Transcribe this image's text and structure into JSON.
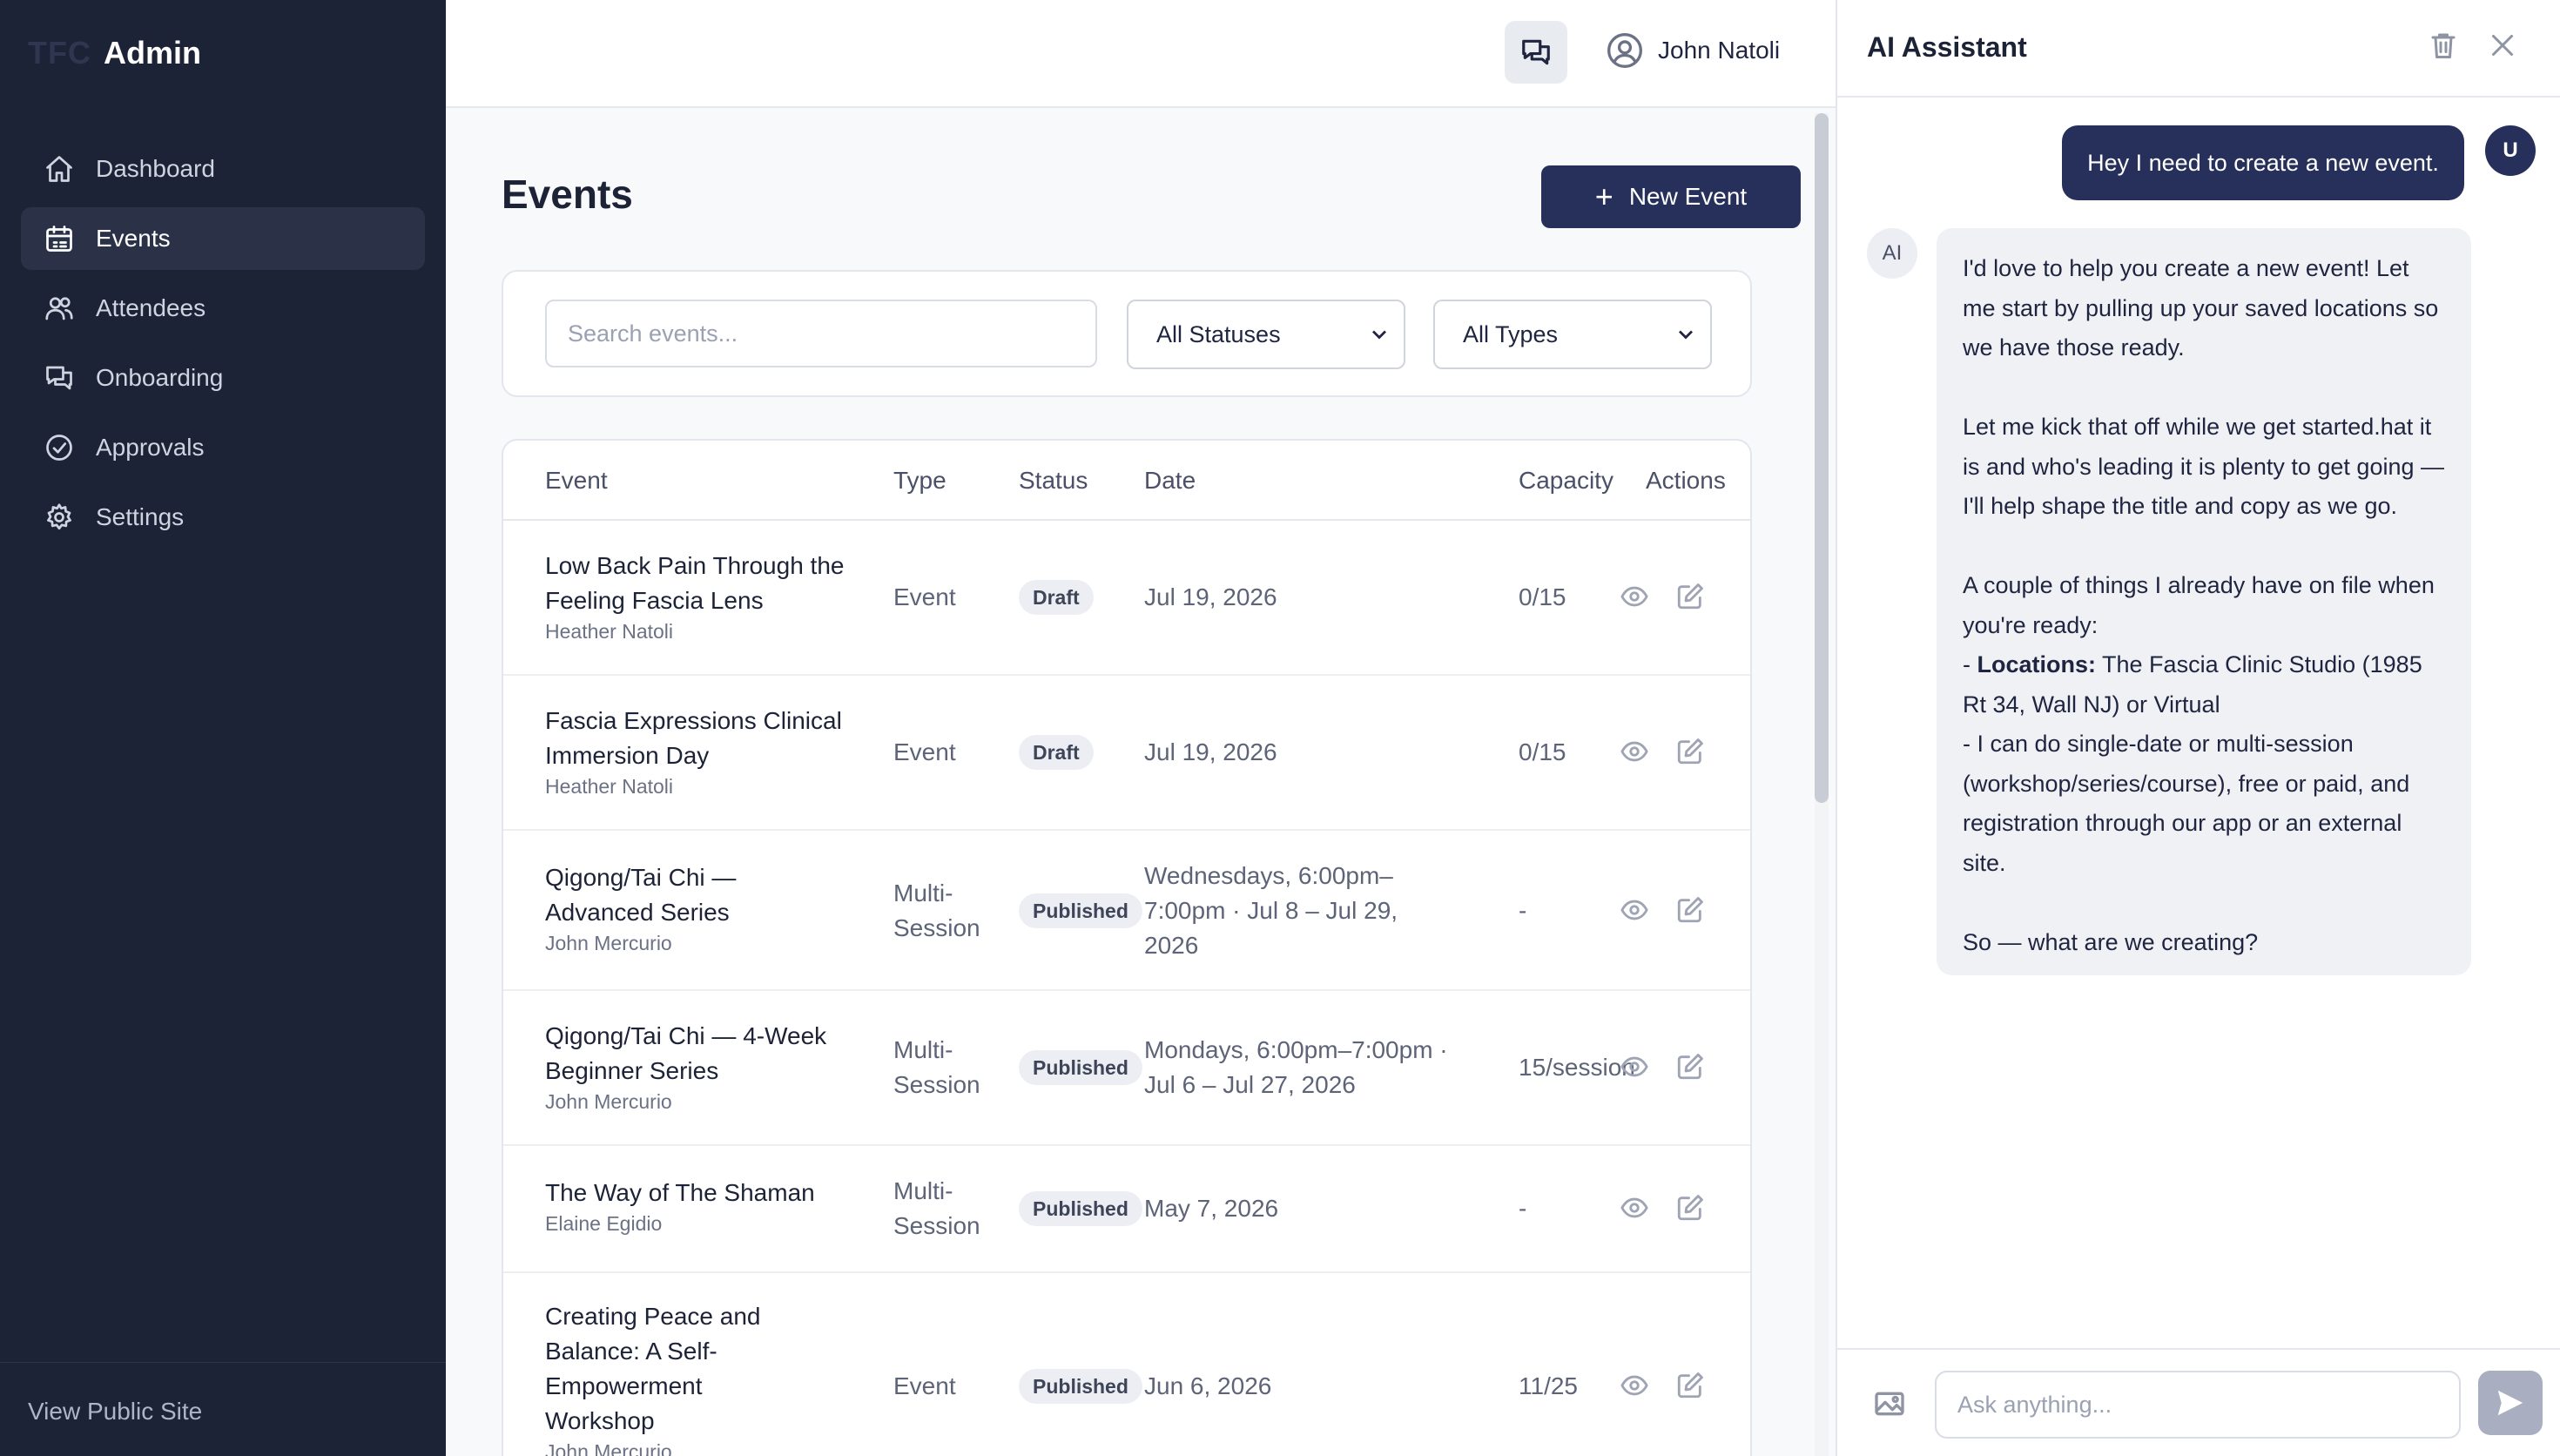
{
  "sidebar": {
    "brand_mark": "TFC",
    "brand_title": "Admin",
    "items": [
      {
        "label": "Dashboard",
        "icon": "home-icon"
      },
      {
        "label": "Events",
        "icon": "calendar-icon"
      },
      {
        "label": "Attendees",
        "icon": "users-icon"
      },
      {
        "label": "Onboarding",
        "icon": "chat-bubbles-icon"
      },
      {
        "label": "Approvals",
        "icon": "check-circle-icon"
      },
      {
        "label": "Settings",
        "icon": "gear-icon"
      }
    ],
    "active": "Events",
    "footer_link": "View Public Site"
  },
  "topbar": {
    "user_name": "John Natoli"
  },
  "main": {
    "title": "Events",
    "new_button": "New Event",
    "search_placeholder": "Search events...",
    "status_filter": "All Statuses",
    "type_filter": "All Types",
    "columns": [
      "Event",
      "Type",
      "Status",
      "Date",
      "Capacity",
      "Actions"
    ],
    "rows": [
      {
        "title": "Low Back Pain Through the Feeling Fascia Lens",
        "host": "Heather Natoli",
        "type": "Event",
        "status": "Draft",
        "date": "Jul 19, 2026",
        "capacity": "0/15"
      },
      {
        "title": "Fascia Expressions Clinical Immersion Day",
        "host": "Heather Natoli",
        "type": "Event",
        "status": "Draft",
        "date": "Jul 19, 2026",
        "capacity": "0/15"
      },
      {
        "title": "Qigong/Tai Chi — Advanced Series",
        "host": "John Mercurio",
        "type": "Multi-Session",
        "status": "Published",
        "date": "Wednesdays, 6:00pm–7:00pm · Jul 8 – Jul 29, 2026",
        "capacity": "-"
      },
      {
        "title": "Qigong/Tai Chi — 4-Week Beginner Series",
        "host": "John Mercurio",
        "type": "Multi-Session",
        "status": "Published",
        "date": "Mondays, 6:00pm–7:00pm · Jul 6 – Jul 27, 2026",
        "capacity": "15/session"
      },
      {
        "title": "The Way of The Shaman",
        "host": "Elaine Egidio",
        "type": "Multi-Session",
        "status": "Published",
        "date": "May 7, 2026",
        "capacity": "-"
      },
      {
        "title": "Creating Peace and Balance: A Self-Empowerment Workshop",
        "host": "John Mercurio",
        "type": "Event",
        "status": "Published",
        "date": "Jun 6, 2026",
        "capacity": "11/25"
      }
    ]
  },
  "assistant": {
    "title": "AI Assistant",
    "user_avatar": "U",
    "ai_avatar": "AI",
    "user_message": "Hey I need to create a new event.",
    "ai_message": {
      "p1": "I'd love to help you create a new event! Let me start by pulling up your saved locations so we have those ready.",
      "p2": "Let me kick that off while we get started.hat it is and who's leading it is plenty to get going — I'll help shape the title and copy as we go.",
      "p3": "A couple of things I already have on file when you're ready:",
      "bullet1_label": "Locations:",
      "bullet1_text": "The Fascia Clinic Studio (1985 Rt 34, Wall NJ) or Virtual",
      "bullet2_text": "I can do single-date or multi-session (workshop/series/course), free or paid, and registration through our app or an external site.",
      "p4": "So — what are we creating?"
    },
    "input_placeholder": "Ask anything..."
  }
}
